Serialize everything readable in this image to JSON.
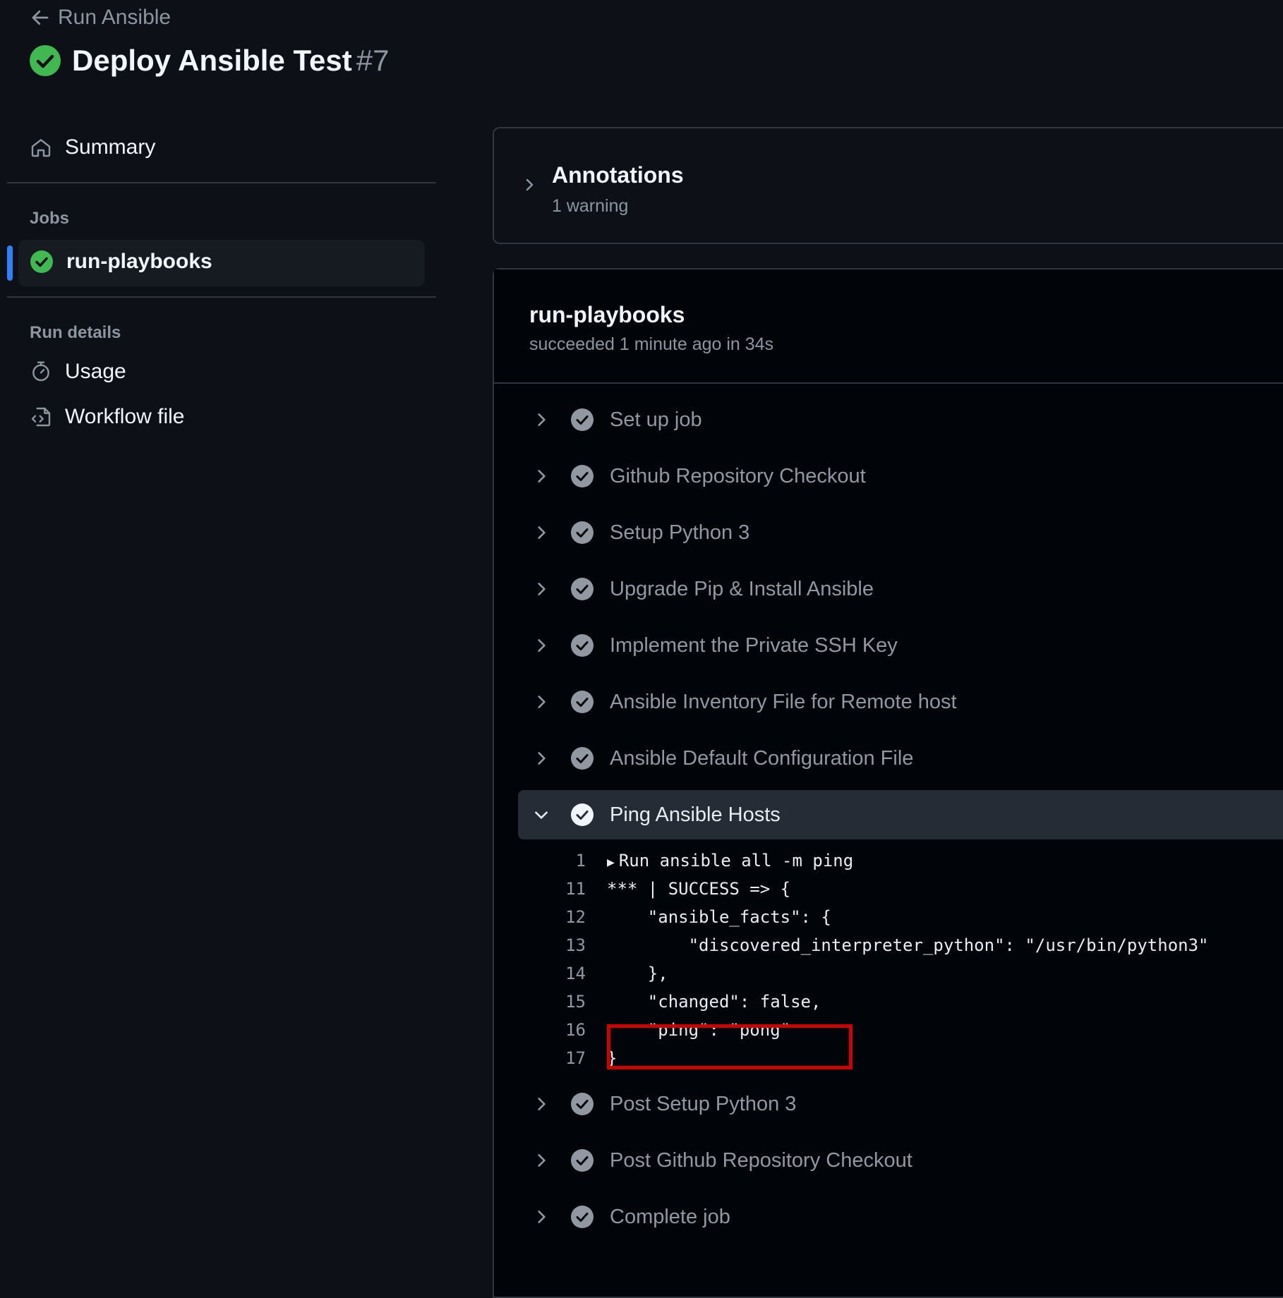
{
  "header": {
    "back_label": "Run Ansible",
    "title": "Deploy Ansible Test",
    "run_number": "#7"
  },
  "sidebar": {
    "summary_label": "Summary",
    "jobs_label": "Jobs",
    "job_name": "run-playbooks",
    "run_details_label": "Run details",
    "usage_label": "Usage",
    "workflow_file_label": "Workflow file"
  },
  "annotations": {
    "title": "Annotations",
    "subtitle": "1 warning"
  },
  "job": {
    "title": "run-playbooks",
    "subtitle": "succeeded 1 minute ago in 34s",
    "steps": [
      {
        "label": "Set up job"
      },
      {
        "label": "Github Repository Checkout"
      },
      {
        "label": "Setup Python 3"
      },
      {
        "label": "Upgrade Pip & Install Ansible"
      },
      {
        "label": "Implement the Private SSH Key"
      },
      {
        "label": "Ansible Inventory File for Remote host"
      },
      {
        "label": "Ansible Default Configuration File"
      },
      {
        "label": "Ping Ansible Hosts"
      },
      {
        "label": "Post Setup Python 3"
      },
      {
        "label": "Post Github Repository Checkout"
      },
      {
        "label": "Complete job"
      }
    ],
    "log": [
      {
        "num": "1",
        "text": "Run ansible all -m ping"
      },
      {
        "num": "11",
        "text": "*** | SUCCESS => {"
      },
      {
        "num": "12",
        "text": "    \"ansible_facts\": {"
      },
      {
        "num": "13",
        "text": "        \"discovered_interpreter_python\": \"/usr/bin/python3\""
      },
      {
        "num": "14",
        "text": "    },"
      },
      {
        "num": "15",
        "text": "    \"changed\": false,"
      },
      {
        "num": "16",
        "text": "    \"ping\": \"pong\""
      },
      {
        "num": "17",
        "text": "}"
      }
    ]
  },
  "colors": {
    "success": "#3fb950",
    "highlight": "#d10000",
    "accent": "#2f81f7"
  }
}
